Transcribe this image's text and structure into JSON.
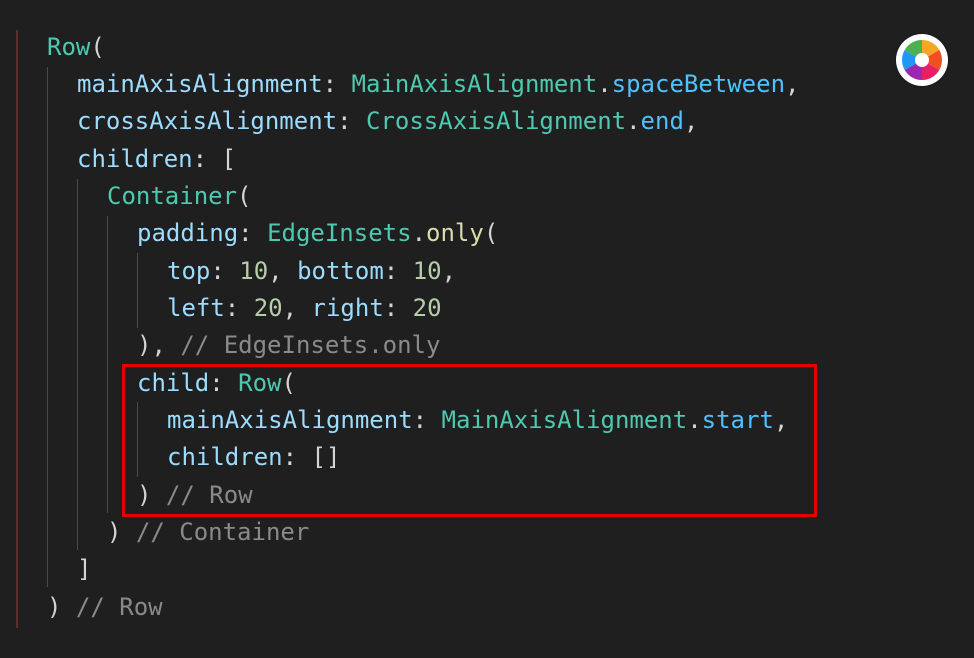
{
  "code": {
    "lines": [
      [
        {
          "t": "Row",
          "c": "cls"
        },
        {
          "t": "(",
          "c": "punc"
        }
      ],
      [
        {
          "t": "mainAxisAlignment",
          "c": "prop"
        },
        {
          "t": ": ",
          "c": "punc"
        },
        {
          "t": "MainAxisAlignment",
          "c": "cls"
        },
        {
          "t": ".",
          "c": "punc"
        },
        {
          "t": "spaceBetween",
          "c": "enumv"
        },
        {
          "t": ",",
          "c": "punc"
        }
      ],
      [
        {
          "t": "crossAxisAlignment",
          "c": "prop"
        },
        {
          "t": ": ",
          "c": "punc"
        },
        {
          "t": "CrossAxisAlignment",
          "c": "cls"
        },
        {
          "t": ".",
          "c": "punc"
        },
        {
          "t": "end",
          "c": "enumv"
        },
        {
          "t": ",",
          "c": "punc"
        }
      ],
      [
        {
          "t": "children",
          "c": "prop"
        },
        {
          "t": ": [",
          "c": "punc"
        }
      ],
      [
        {
          "t": "Container",
          "c": "cls"
        },
        {
          "t": "(",
          "c": "punc"
        }
      ],
      [
        {
          "t": "padding",
          "c": "prop"
        },
        {
          "t": ": ",
          "c": "punc"
        },
        {
          "t": "EdgeInsets",
          "c": "cls"
        },
        {
          "t": ".",
          "c": "punc"
        },
        {
          "t": "only",
          "c": "meth"
        },
        {
          "t": "(",
          "c": "punc"
        }
      ],
      [
        {
          "t": "top",
          "c": "prop"
        },
        {
          "t": ": ",
          "c": "punc"
        },
        {
          "t": "10",
          "c": "num"
        },
        {
          "t": ", ",
          "c": "punc"
        },
        {
          "t": "bottom",
          "c": "prop"
        },
        {
          "t": ": ",
          "c": "punc"
        },
        {
          "t": "10",
          "c": "num"
        },
        {
          "t": ",",
          "c": "punc"
        }
      ],
      [
        {
          "t": "left",
          "c": "prop"
        },
        {
          "t": ": ",
          "c": "punc"
        },
        {
          "t": "20",
          "c": "num"
        },
        {
          "t": ", ",
          "c": "punc"
        },
        {
          "t": "right",
          "c": "prop"
        },
        {
          "t": ": ",
          "c": "punc"
        },
        {
          "t": "20",
          "c": "num"
        }
      ],
      [
        {
          "t": "), ",
          "c": "punc"
        },
        {
          "t": "// EdgeInsets.only",
          "c": "cmt"
        }
      ],
      [
        {
          "t": "child",
          "c": "prop"
        },
        {
          "t": ": ",
          "c": "punc"
        },
        {
          "t": "Row",
          "c": "cls"
        },
        {
          "t": "(",
          "c": "punc"
        }
      ],
      [
        {
          "t": "mainAxisAlignment",
          "c": "prop"
        },
        {
          "t": ": ",
          "c": "punc"
        },
        {
          "t": "MainAxisAlignment",
          "c": "cls"
        },
        {
          "t": ".",
          "c": "punc"
        },
        {
          "t": "start",
          "c": "enumv"
        },
        {
          "t": ",",
          "c": "punc"
        }
      ],
      [
        {
          "t": "children",
          "c": "prop"
        },
        {
          "t": ": []",
          "c": "punc"
        }
      ],
      [
        {
          "t": ") ",
          "c": "punc"
        },
        {
          "t": "// Row",
          "c": "cmt"
        }
      ],
      [
        {
          "t": ") ",
          "c": "punc"
        },
        {
          "t": "// Container",
          "c": "cmt"
        }
      ],
      [
        {
          "t": "]",
          "c": "punc"
        }
      ],
      [
        {
          "t": ") ",
          "c": "punc"
        },
        {
          "t": "// Row",
          "c": "cmt"
        }
      ]
    ]
  },
  "colors": {
    "background": "#1f1f1f",
    "class": "#4ec9b0",
    "property": "#9cdcfe",
    "method": "#dcdcaa",
    "number": "#b5cea8",
    "enum_value": "#4fc1ff",
    "comment": "#8a8a8a",
    "highlight_border": "#e50000"
  },
  "icons": {
    "color_wheel": "color-wheel-icon"
  }
}
